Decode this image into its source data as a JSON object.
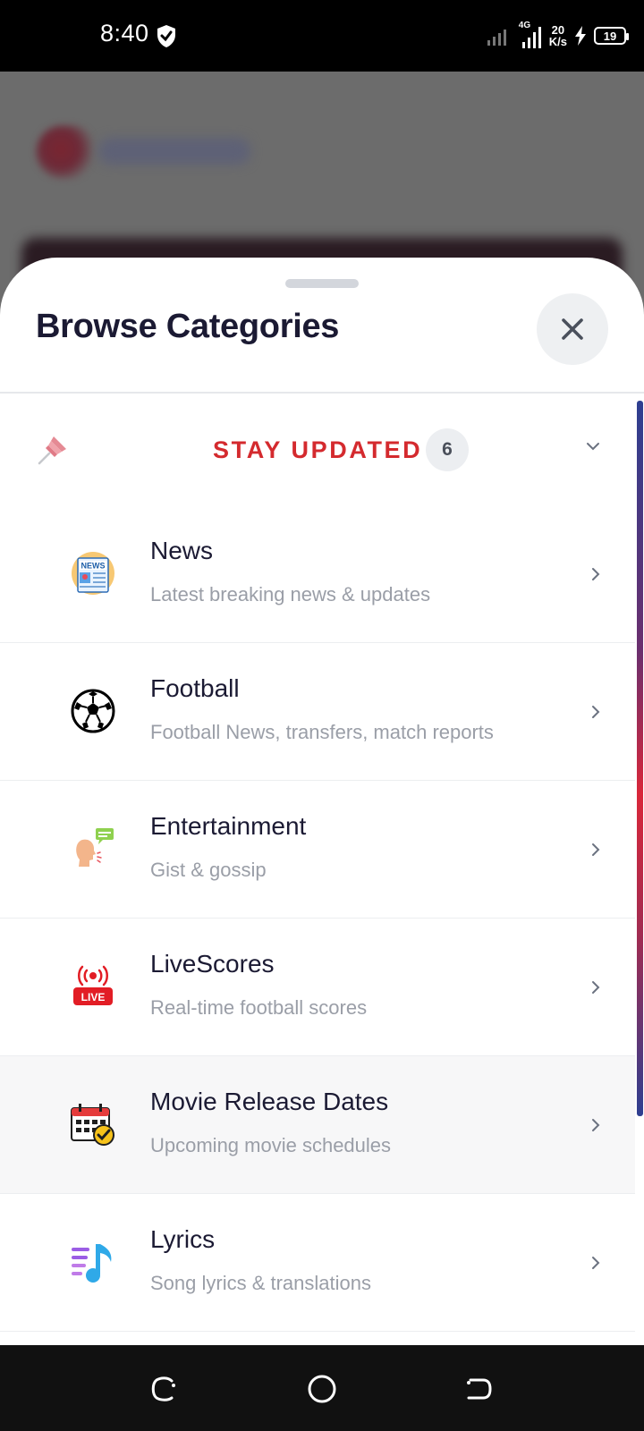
{
  "status_bar": {
    "time": "8:40",
    "network_type": "4G",
    "speed_value": "20",
    "speed_unit": "K/s",
    "battery": "19"
  },
  "sheet": {
    "title": "Browse Categories",
    "close_icon": "close-icon"
  },
  "section": {
    "title": "STAY UPDATED",
    "count": "6",
    "icon": "pushpin-icon",
    "accent_color": "#d42a2e"
  },
  "categories": [
    {
      "title": "News",
      "subtitle": "Latest breaking news & updates",
      "icon": "newspaper-icon"
    },
    {
      "title": "Football",
      "subtitle": "Football News, transfers, match reports",
      "icon": "soccer-ball-icon"
    },
    {
      "title": "Entertainment",
      "subtitle": "Gist & gossip",
      "icon": "speaking-head-icon"
    },
    {
      "title": "LiveScores",
      "subtitle": "Real-time football scores",
      "icon": "live-broadcast-icon"
    },
    {
      "title": "Movie Release Dates",
      "subtitle": "Upcoming movie schedules",
      "icon": "calendar-check-icon"
    },
    {
      "title": "Lyrics",
      "subtitle": "Song lyrics & translations",
      "icon": "music-list-icon"
    }
  ],
  "nav": {
    "recents": "recents-icon",
    "home": "home-icon",
    "back": "back-icon"
  }
}
